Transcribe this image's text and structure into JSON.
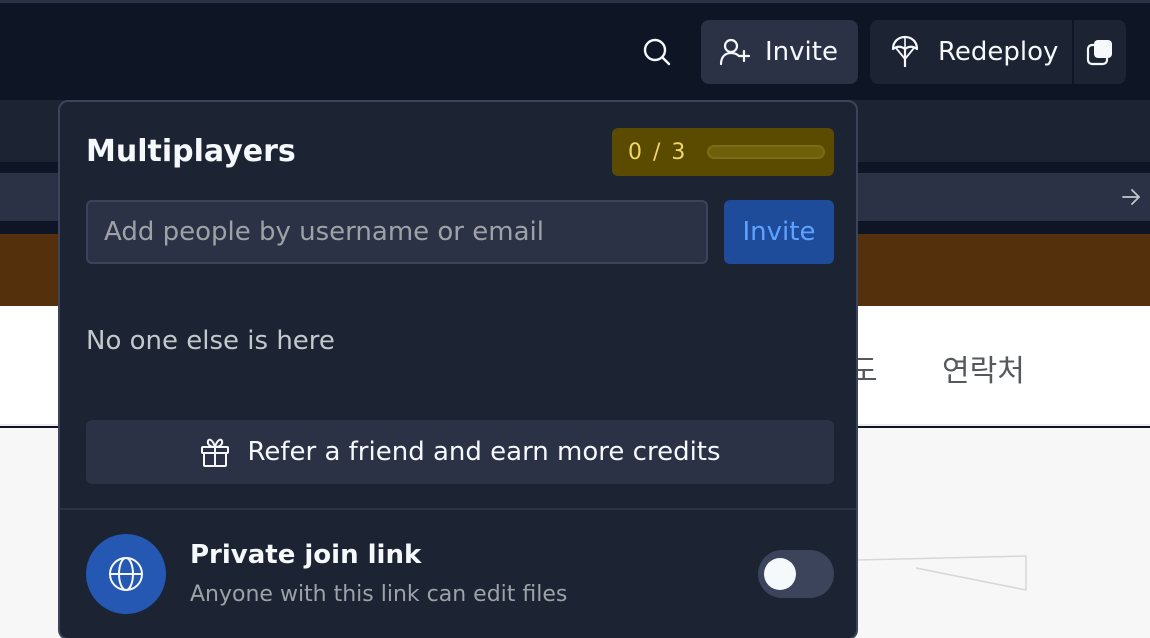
{
  "topbar": {
    "invite_label": "Invite",
    "redeploy_label": "Redeploy"
  },
  "background": {
    "nav_item_partial": "도",
    "nav_item_contact": "연락처"
  },
  "popover": {
    "title": "Multiplayers",
    "usage": {
      "count_text": "0 / 3",
      "used": 0,
      "limit": 3
    },
    "invite_input_placeholder": "Add people by username or email",
    "invite_input_value": "",
    "invite_button_label": "Invite",
    "empty_message": "No one else is here",
    "refer_label": "Refer a friend and earn more credits",
    "private_link": {
      "title": "Private join link",
      "subtitle": "Anyone with this link can edit files",
      "enabled": false
    }
  },
  "colors": {
    "bg_dark": "#0e1525",
    "surface": "#1c2333",
    "surface_raised": "#2b3245",
    "accent_blue": "#2458b3",
    "invite_text_blue": "#5ea2ff",
    "usage_yellow": "#f2d66a",
    "banner_brown": "#55300c"
  },
  "icons": {
    "search": "search-icon",
    "invite": "user-plus-icon",
    "redeploy": "deploy-icon",
    "devices": "devices-icon",
    "arrow": "arrow-right-icon",
    "refer": "gift-icon",
    "private_link": "globe-icon"
  }
}
